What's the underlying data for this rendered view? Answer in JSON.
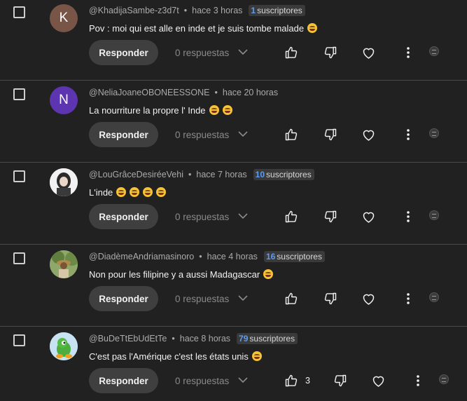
{
  "comments": [
    {
      "author": "@KhadijaSambe-z3d7t",
      "time": "hace 3 horas",
      "subs_count": "1",
      "subs_label": "suscriptores",
      "text": "Pov : moi qui est alle en inde et je suis tombe malade",
      "emoji_count": 1,
      "avatar_letter": "K",
      "avatar_color": "#795548",
      "reply_label": "Responder",
      "replies_label": "0 respuestas",
      "likes": ""
    },
    {
      "author": "@NeliaJoaneOBONEESSONE",
      "time": "hace 20 horas",
      "subs_count": "",
      "subs_label": "",
      "text": "La nourriture la propre l' Inde",
      "emoji_count": 2,
      "avatar_letter": "N",
      "avatar_color": "#5e35b1",
      "reply_label": "Responder",
      "replies_label": "0 respuestas",
      "likes": ""
    },
    {
      "author": "@LouGrâceDesiréeVehi",
      "time": "hace 7 horas",
      "subs_count": "10",
      "subs_label": "suscriptores",
      "text": "L'inde",
      "emoji_count": 4,
      "avatar_letter": "",
      "avatar_color": "#e8e8e8",
      "reply_label": "Responder",
      "replies_label": "0 respuestas",
      "likes": ""
    },
    {
      "author": "@DiadèmeAndriamasinoro",
      "time": "hace 4 horas",
      "subs_count": "16",
      "subs_label": "suscriptores",
      "text": "Non pour les filipine y a aussi Madagascar",
      "emoji_count": 1,
      "avatar_letter": "",
      "avatar_color": "#6b8a4e",
      "reply_label": "Responder",
      "replies_label": "0 respuestas",
      "likes": ""
    },
    {
      "author": "@BuDeTtEbUdEtTe",
      "time": "hace 8 horas",
      "subs_count": "79",
      "subs_label": "suscriptores",
      "text": "C'est pas l'Amérique c'est les états unis",
      "emoji_count": 1,
      "avatar_letter": "",
      "avatar_color": "#b9d7ea",
      "reply_label": "Responder",
      "replies_label": "0 respuestas",
      "likes": "3"
    }
  ],
  "icons": {
    "like": "thumb-up-icon",
    "dislike": "thumb-down-icon",
    "heart": "heart-icon",
    "menu": "more-vert-icon",
    "expand": "chevron-down-icon"
  },
  "colors": {
    "background": "#212121",
    "subs_accent": "#5b9df5",
    "button_bg": "#3f3f3f"
  }
}
